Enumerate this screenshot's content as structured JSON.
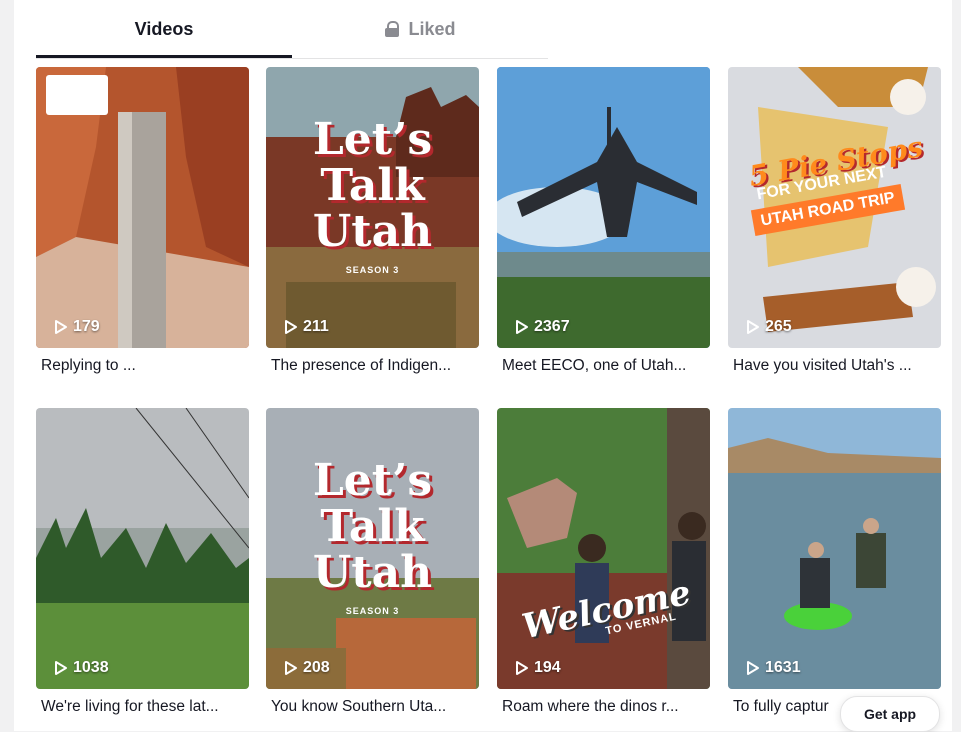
{
  "tabs": {
    "videos": "Videos",
    "liked": "Liked"
  },
  "videos": [
    {
      "views": "179",
      "caption": "Replying to ..."
    },
    {
      "views": "211",
      "caption": "The presence of Indigen...",
      "overlay_title": "Let's\nTalk\nUtah",
      "overlay_sub": "SEASON 3"
    },
    {
      "views": "2367",
      "caption": "Meet EECO, one of Utah..."
    },
    {
      "views": "265",
      "caption": "Have you visited Utah's ...",
      "overlay_title": "5 Pie Stops",
      "overlay_sub": "FOR YOUR NEXT",
      "overlay_banner": "UTAH ROAD TRIP"
    },
    {
      "views": "1038",
      "caption": "We're living for these lat..."
    },
    {
      "views": "208",
      "caption": "You know Southern Uta...",
      "overlay_title": "Let's\nTalk\nUtah",
      "overlay_sub": "SEASON 3"
    },
    {
      "views": "194",
      "caption": "Roam where the dinos r...",
      "overlay_title": "Welcome",
      "overlay_sub": "TO VERNAL"
    },
    {
      "views": "1631",
      "caption": "To fully captur"
    }
  ],
  "get_app": "Get app",
  "icons": {
    "play": "play-icon",
    "lock": "lock-icon"
  }
}
